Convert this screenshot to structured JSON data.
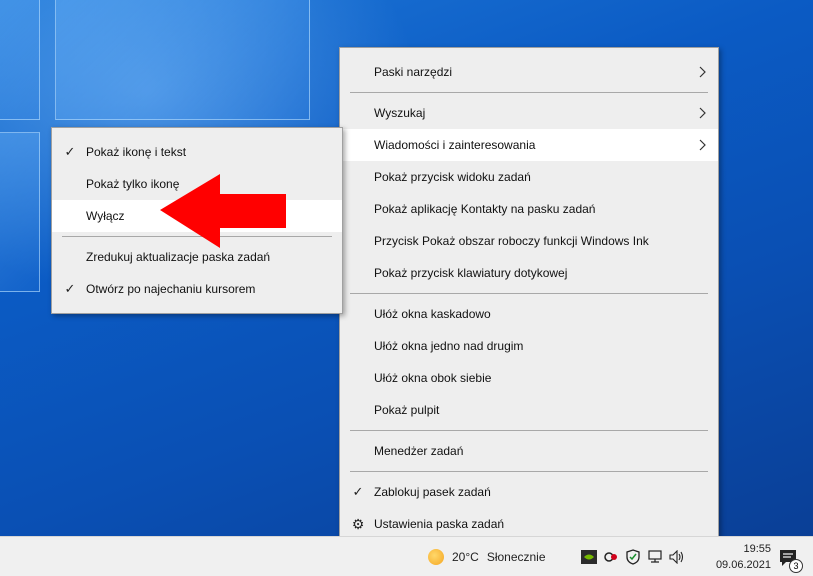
{
  "colors": {
    "desktop": "#0b5bc4",
    "menu_bg": "#eeeeee",
    "menu_highlight": "#ffffff",
    "arrow": "#ff0000"
  },
  "taskbar_menu": {
    "items": [
      {
        "label": "Paski narzędzi",
        "submenu": true
      },
      {
        "label": "Wyszukaj",
        "submenu": true
      },
      {
        "label": "Wiadomości i zainteresowania",
        "submenu": true,
        "highlighted": true
      },
      {
        "label": "Pokaż przycisk widoku zadań"
      },
      {
        "label": "Pokaż aplikację Kontakty na pasku zadań"
      },
      {
        "label": "Przycisk Pokaż obszar roboczy funkcji Windows Ink"
      },
      {
        "label": "Pokaż przycisk klawiatury dotykowej"
      },
      {
        "label": "Ułóż okna kaskadowo"
      },
      {
        "label": "Ułóż okna jedno nad drugim"
      },
      {
        "label": "Ułóż okna obok siebie"
      },
      {
        "label": "Pokaż pulpit"
      },
      {
        "label": "Menedżer zadań"
      },
      {
        "label": "Zablokuj pasek zadań",
        "checked": true
      },
      {
        "label": "Ustawienia paska zadań",
        "icon": "gear-icon"
      }
    ]
  },
  "news_submenu": {
    "items": [
      {
        "label": "Pokaż ikonę i tekst",
        "checked": true
      },
      {
        "label": "Pokaż tylko ikonę"
      },
      {
        "label": "Wyłącz",
        "highlighted": true
      },
      {
        "label": "Zredukuj aktualizacje paska zadań"
      },
      {
        "label": "Otwórz po najechaniu kursorem",
        "checked": true
      }
    ]
  },
  "taskbar": {
    "weather": {
      "temp": "20°C",
      "condition": "Słonecznie",
      "icon": "sun-icon"
    },
    "clock": {
      "time": "19:55",
      "date": "09.06.2021"
    },
    "notification_count": "3"
  }
}
